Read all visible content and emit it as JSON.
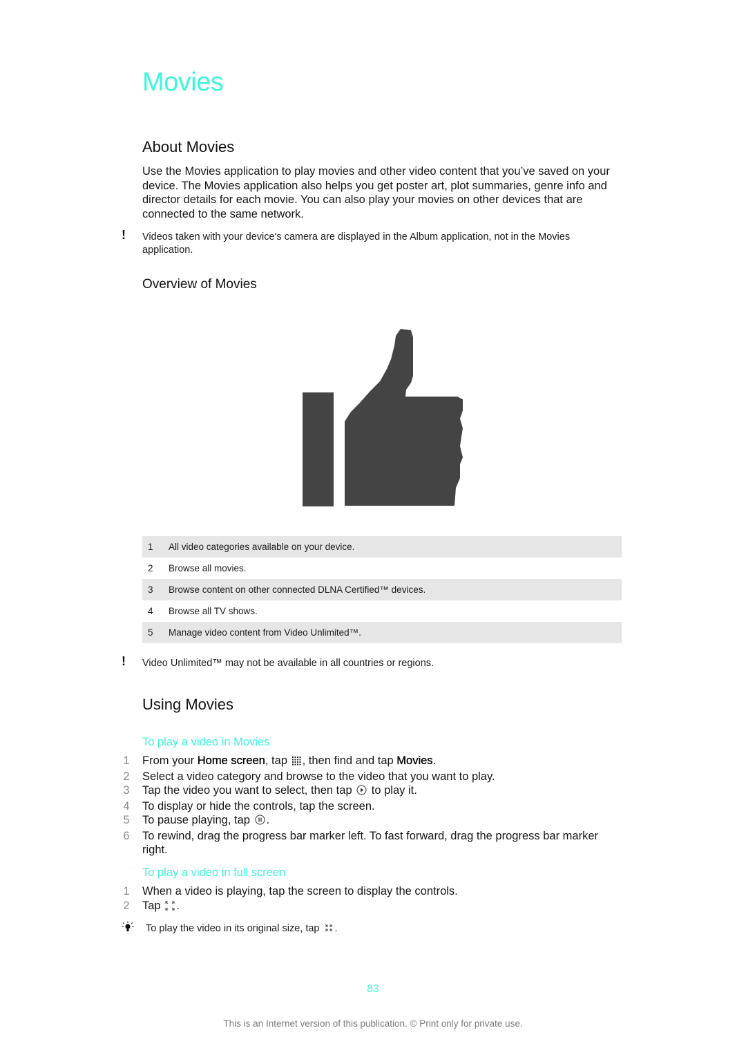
{
  "page": {
    "title": "Movies",
    "sections": {
      "about": {
        "heading": "About Movies",
        "paragraph": "Use the Movies application to play movies and other video content that you’ve saved on your device. The Movies application also helps you get poster art, plot summaries, genre info and director details for each movie. You can also play your movies on other devices that are connected to the same network.",
        "note": "Videos taken with your device's camera are displayed in the Album application, not in the Movies application.",
        "note_icon": "exclamation-icon"
      },
      "overview": {
        "heading": "Overview of Movies",
        "figure_icon": "thumbs-up-icon",
        "legend": [
          {
            "num": "1",
            "text": "All video categories available on your device."
          },
          {
            "num": "2",
            "text": "Browse all movies."
          },
          {
            "num": "3",
            "text": "Browse content on other connected DLNA Certified™ devices."
          },
          {
            "num": "4",
            "text": "Browse all TV shows."
          },
          {
            "num": "5",
            "text": "Manage video content from Video Unlimited™."
          }
        ],
        "note": "Video Unlimited™ may not be available in all countries or regions.",
        "note_icon": "exclamation-icon"
      },
      "using": {
        "heading": "Using Movies",
        "play_in_movies": {
          "heading": "To play a video in Movies",
          "steps": [
            {
              "num": "1",
              "pre": "From your ",
              "bold1": "Home screen",
              "mid": ", tap ",
              "icon": "app-grid-icon",
              "post": ", then find and tap ",
              "bold2": "Movies",
              "end": "."
            },
            {
              "num": "2",
              "text": "Select a video category and browse to the video that you want to play."
            },
            {
              "num": "3",
              "pre": "Tap the video you want to select, then tap ",
              "icon": "play-icon",
              "post": " to play it."
            },
            {
              "num": "4",
              "text": "To display or hide the controls, tap the screen."
            },
            {
              "num": "5",
              "pre": "To pause playing, tap ",
              "icon": "pause-icon",
              "post": "."
            },
            {
              "num": "6",
              "text": "To rewind, drag the progress bar marker left. To fast forward, drag the progress bar marker right."
            }
          ]
        },
        "play_full_screen": {
          "heading": "To play a video in full screen",
          "steps": [
            {
              "num": "1",
              "text": "When a video is playing, tap the screen to display the controls."
            },
            {
              "num": "2",
              "pre": "Tap ",
              "icon": "fullscreen-icon",
              "post": "."
            }
          ],
          "tip": {
            "pre": "To play the video in its original size, tap ",
            "icon": "exit-fullscreen-icon",
            "post": ".",
            "tip_icon": "lightbulb-icon"
          }
        }
      }
    },
    "page_number": "83",
    "footer": "This is an Internet version of this publication. © Print only for private use."
  }
}
